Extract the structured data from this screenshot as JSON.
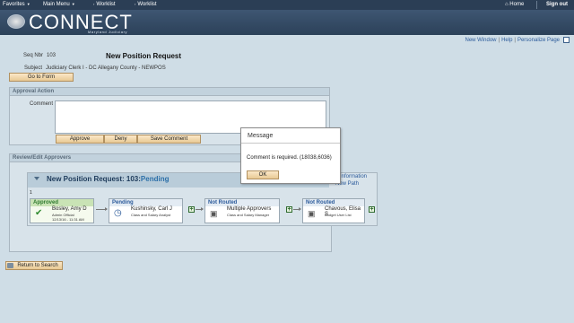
{
  "topnav": {
    "favorites": "Favorites",
    "main_menu": "Main Menu",
    "crumb1": "Worklist",
    "crumb2": "Worklist",
    "home": "Home",
    "signout": "Sign out"
  },
  "header": {
    "brand": "CONNECT",
    "brand_sub": "Maryland Judiciary"
  },
  "utility_links": [
    "New Window",
    "Help",
    "Personalize Page"
  ],
  "form": {
    "seq_label": "Seq Nbr",
    "seq_value": "103",
    "title": "New Position Request",
    "subject_label": "Subject",
    "subject_value": "Judiciary Clerk I - DC Allegany County - NEWPOS",
    "goto_button": "Go to Form"
  },
  "approval": {
    "header": "Approval Action",
    "comment_label": "Comment",
    "comment_value": "",
    "approve_button": "Approve",
    "deny_button": "Deny",
    "save_comment_button": "Save Comment"
  },
  "review": {
    "header": "Review/Edit Approvers",
    "flow_title": "New Position Request: 103:",
    "flow_status": "Pending",
    "link_request_info": "uest Information",
    "link_new_path": "New Path",
    "step_number": "1",
    "steps": [
      {
        "status": "Approved",
        "name": "Bosley, Amy D",
        "role1": "Admin Official",
        "role2": "12/13/16 - 11:31 AM",
        "status_color": "#2f7a2f",
        "icon": "check-icon"
      },
      {
        "status": "Pending",
        "name": "Kushinsky, Carl J",
        "role1": "Class and Salary Analyst",
        "role2": "",
        "status_color": "#2b5a9a",
        "icon": "clock-icon"
      },
      {
        "status": "Not Routed",
        "name": "Multiple Approvers",
        "role1": "Class and Salary Manager",
        "role2": "",
        "status_color": "#2b5a9a",
        "icon": "people-icon"
      },
      {
        "status": "Not Routed",
        "name": "Chavous, Elisa S",
        "role1": "Budget User List",
        "role2": "",
        "status_color": "#2b5a9a",
        "icon": "person-icon"
      }
    ]
  },
  "return_button": "Return to Search",
  "modal": {
    "title": "Message",
    "message": "Comment is required. (18038,6036)",
    "ok_button": "OK"
  },
  "colors": {
    "nav_bg": "#2b3e55",
    "page_bg": "#cfdde6",
    "button_bg": "#f3d9ac",
    "link": "#2b5a9a"
  }
}
